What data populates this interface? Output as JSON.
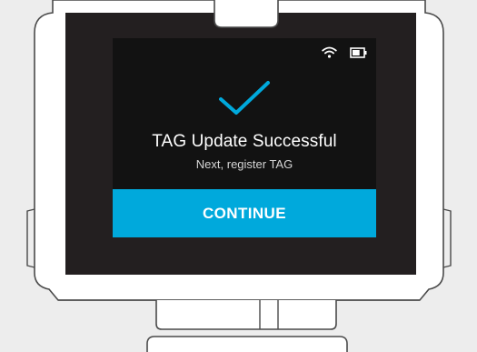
{
  "screen": {
    "title": "TAG Update Successful",
    "subtitle": "Next, register TAG",
    "continue_label": "CONTINUE"
  },
  "status_bar": {
    "icons": [
      "wifi-icon",
      "battery-icon"
    ],
    "battery_level": 0.7
  },
  "colors": {
    "accent": "#00a9dc",
    "screen_background": "#121212",
    "device_frame": "#231f20",
    "device_body": "#ffffff",
    "device_outline": "#4a4a4a",
    "page_background": "#ededed"
  },
  "icons": {
    "success": "checkmark-icon"
  }
}
